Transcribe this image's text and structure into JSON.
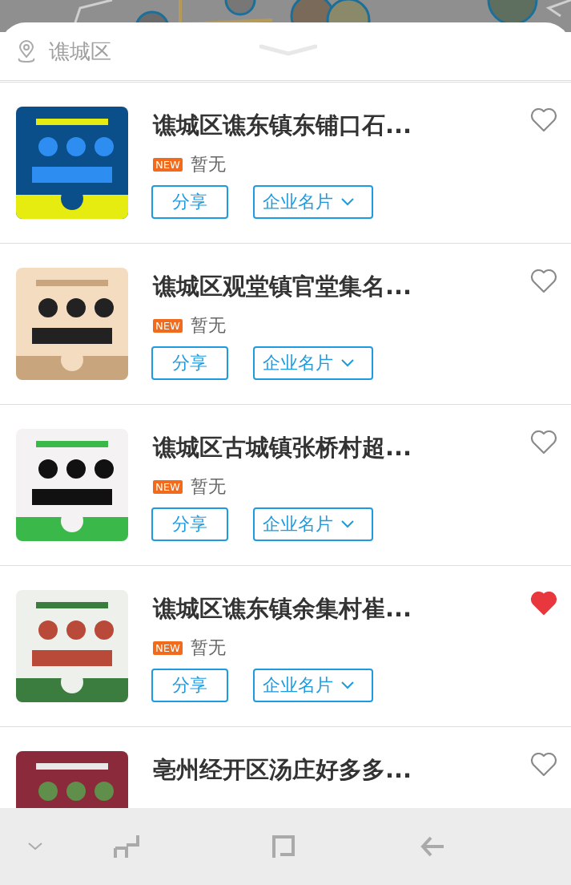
{
  "location": {
    "label": "谯城区"
  },
  "items": [
    {
      "title": "谯城区谯东镇东铺口石...",
      "badge": "NEW",
      "subtitle": "暂无",
      "liked": false,
      "share": "分享",
      "card": "企业名片"
    },
    {
      "title": "谯城区观堂镇官堂集名...",
      "badge": "NEW",
      "subtitle": "暂无",
      "liked": false,
      "share": "分享",
      "card": "企业名片"
    },
    {
      "title": "谯城区古城镇张桥村超...",
      "badge": "NEW",
      "subtitle": "暂无",
      "liked": false,
      "share": "分享",
      "card": "企业名片"
    },
    {
      "title": "谯城区谯东镇余集村崔...",
      "badge": "NEW",
      "subtitle": "暂无",
      "liked": true,
      "share": "分享",
      "card": "企业名片"
    },
    {
      "title": "亳州经开区汤庄好多多...",
      "liked": false
    }
  ]
}
